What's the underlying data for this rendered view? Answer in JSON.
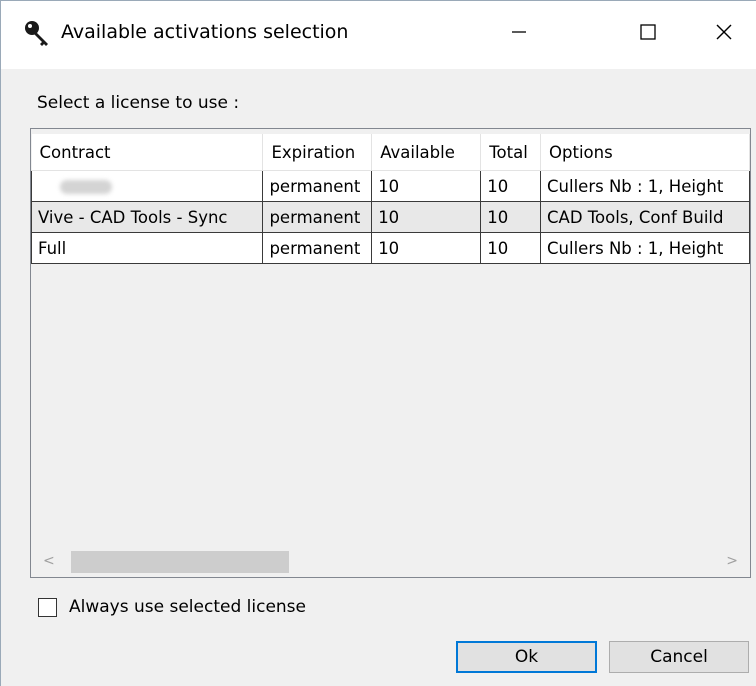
{
  "window": {
    "title": "Available activations selection",
    "title_icon": "key-icon",
    "controls": {
      "minimize_icon": "minimize-icon",
      "maximize_icon": "maximize-icon",
      "close_icon": "close-icon"
    }
  },
  "prompt": "Select a license to use :",
  "table": {
    "columns": [
      "Contract",
      "Expiration",
      "Available",
      "Total",
      "Options"
    ],
    "rows": [
      {
        "contract": "",
        "expiration": "permanent",
        "available": "10",
        "total": "10",
        "options": "Cullers Nb : 1, Height"
      },
      {
        "contract": "Vive - CAD Tools - Sync",
        "expiration": "permanent",
        "available": "10",
        "total": "10",
        "options": "CAD Tools, Conf Build"
      },
      {
        "contract": "Full",
        "expiration": "permanent",
        "available": "10",
        "total": "10",
        "options": "Cullers Nb : 1, Height"
      }
    ]
  },
  "scrollbar": {
    "left_arrow": "<",
    "right_arrow": ">"
  },
  "always_use": {
    "label": "Always use selected license",
    "checked": false
  },
  "buttons": {
    "ok": "Ok",
    "cancel": "Cancel"
  },
  "colors": {
    "accent": "#0078d7",
    "window_bg": "#f0f0f0"
  }
}
